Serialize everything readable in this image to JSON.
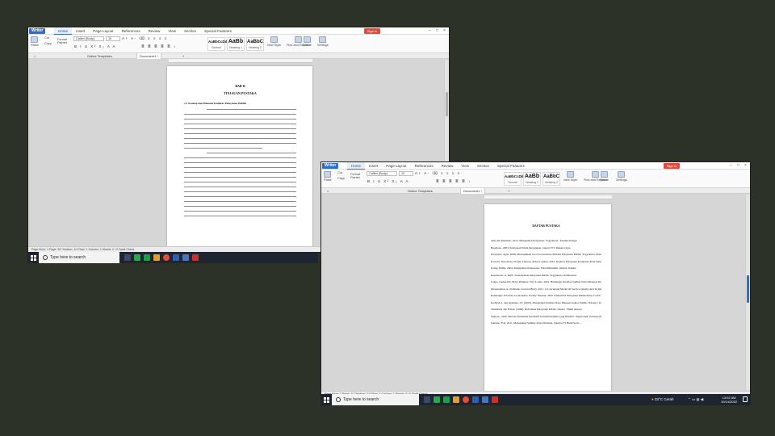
{
  "app": {
    "name": "Writer",
    "menu": [
      "Home",
      "Insert",
      "Page Layout",
      "References",
      "Review",
      "View",
      "Section",
      "Special Features"
    ],
    "sign_in": "Sign in",
    "font_name": "Calibri (Body)",
    "font_size": "10",
    "ribbon": {
      "paste": "Paste",
      "cut": "Cut",
      "copy": "Copy",
      "format_painter": "Format Painter",
      "styles": [
        {
          "preview": "AaBbCcDd",
          "name": "Normal"
        },
        {
          "preview": "AaBb",
          "name": "Heading 1"
        },
        {
          "preview": "AaBbC",
          "name": "Heading 2"
        }
      ],
      "new_style": "New Style",
      "find_replace": "Find and Replace",
      "select": "Select",
      "settings": "Settings",
      "format_row1": "A+ A-  ⌫  ≡ ≡ ≡ ≡",
      "format_row2": "B I U  X² X₂  A  A",
      "para_row": "≣ ≣ ≣ ≣ ≣  ↕"
    },
    "tabs": [
      "Online Templates",
      "Document1 *"
    ],
    "colors": {
      "accent": "#2f6ec7",
      "signin": "#e2483b",
      "taskbar": "#1f2530"
    }
  },
  "window1": {
    "heading1": "BAB II",
    "heading2": "TINJAUAN PUSTAKA",
    "section": "2.1      Konsep dan Dimensi Kualitas Pelayanan Publik",
    "status": "Page Num: 1    Page: 3/1    Section: 1/1    Row: 1    Column: 1    Words: 0 / 0    Spell Check"
  },
  "window2": {
    "heading": "DAFTAR PUSTAKA",
    "refs": [
      "Atik dan Ratminto. 2012. Manajemen Pelayanan. Yogyakarta : Pustaka Pelajar.",
      "Boediono. 2003. Pelayanan Prima Perpajakan. Jakarta: PT. Rineka Cipta.",
      "Dwiyanto, Agus. 2008. Mewujudkan Good Governance Melalui Pelayanan Publik. Yogyakarta: Pustaka Pelajar.",
      "Kawatu, Theodorus, Frenny Tulusan, Alden Laloma. 2022. Kualitas Pelayanan Kesehatan Pada Sistem Rujukan Covid 19 Di Puskesmas Tatap Kota ...",
      "Kotler, Philip. 2004. Manajemen Pemasaran. Edisi Milenium. Jakarta: Indeks.",
      "Kurniawan, A. 2005. Transformasi Pelayanan Publik. Yogyakarta: Pembaruan.",
      "Lengo, Gemerally, Maya Pangkey, Very Londa. 2022. Hubungan Kualitas Sumber Daya Manusia Dengan Pelayanan Kesehatan Pada PUSKESMAS ...",
      "Parasuraman, A. Zeithaml, Leonard Berry. 2011. A Conceptual Model Of Service Quality And Its Implications For Future Research.",
      "Ratulangie, Priscilla, Ivone Rares, Frenny Tulusan. 2022. Efektivitas Pelayanan Publik Masa Covid-19 Di Kantor Kelurahan ...",
      "Rodiyah, I. dan Agustina, I.F. (2020). Manajemen Sumber Daya Manusia Sektor Publik. Sidoarjo: Universitas Muhammadiyah.",
      "Sinambela dan Poltak. (2008). Reformasi Pelayanan Publik. Jakarta : Bumi Aksara.",
      "Sugiono. 2020. Metode Penelitian Kualitatif Untuk Penelitian yang Bersifat : Eksploratif, Enterpretif, Interaktif dan Konstruktif. Bandung : Alfabeta.",
      "Sutrisno, Edy. 2011. Manajemen Sumber Daya Manusia. Jakarta: PT Bumi Serta ..."
    ],
    "status": "Page Num: 1    Page: 1/1    Section: 1/1    Row: 1    Column: 1    Words: 0 / 0    Spell Check"
  },
  "taskbar": {
    "search_placeholder": "Type here to search",
    "weather": "33°C  Cerah",
    "time": "13:02 AM",
    "date": "10/14/2022"
  }
}
